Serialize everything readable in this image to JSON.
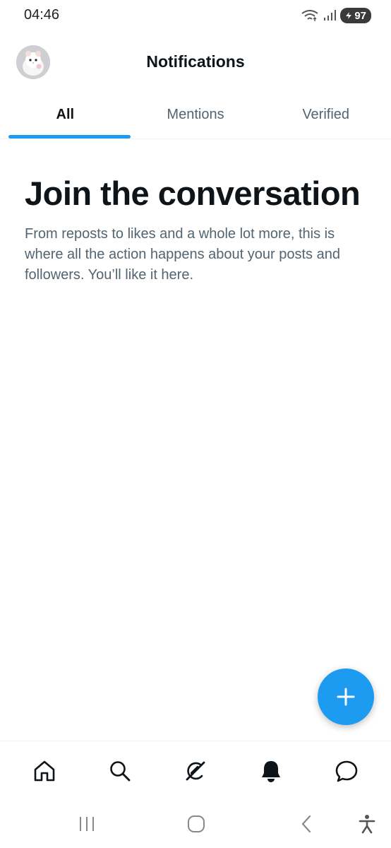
{
  "status_bar": {
    "time": "04:46",
    "battery_level": "97",
    "icons": [
      "wifi-icon",
      "signal-icon",
      "battery-icon"
    ]
  },
  "header": {
    "title": "Notifications",
    "avatar_icon": "avatar"
  },
  "tabs": [
    {
      "label": "All",
      "active": true
    },
    {
      "label": "Mentions",
      "active": false
    },
    {
      "label": "Verified",
      "active": false
    }
  ],
  "empty_state": {
    "title": "Join the conversation",
    "body": "From reposts to likes and a whole lot more, this is where all the action happens about your posts and followers. You’ll like it here."
  },
  "fab": {
    "icon": "plus-icon"
  },
  "bottom_nav": [
    {
      "icon": "home-icon"
    },
    {
      "icon": "search-icon"
    },
    {
      "icon": "grok-icon"
    },
    {
      "icon": "bell-icon",
      "active": true
    },
    {
      "icon": "chat-icon"
    }
  ],
  "system_nav": [
    "recents-icon",
    "home-circle-icon",
    "back-icon",
    "accessibility-icon"
  ],
  "colors": {
    "accent": "#1d9bf0",
    "text_primary": "#0f1419",
    "text_secondary": "#536471"
  }
}
